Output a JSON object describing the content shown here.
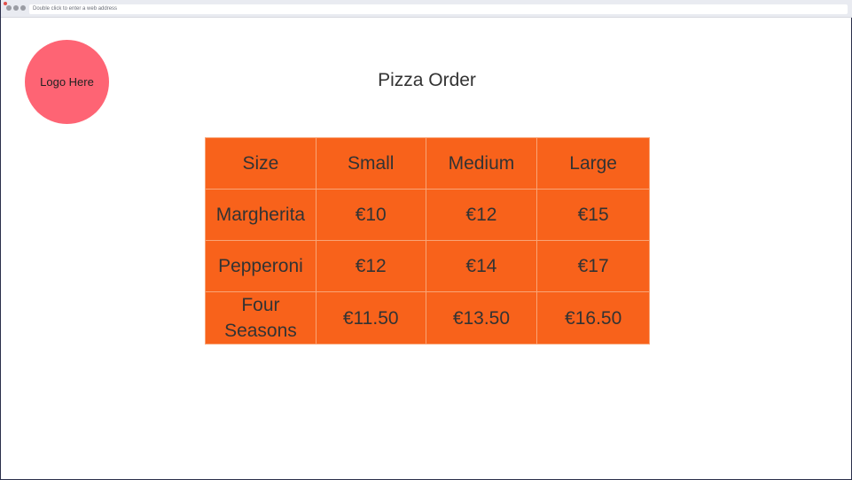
{
  "browser": {
    "address_placeholder": "Double click to enter a web address"
  },
  "logo": {
    "text": "Logo Here",
    "color": "#fe6474"
  },
  "page": {
    "title": "Pizza Order"
  },
  "table": {
    "background_color": "#f8621b",
    "header": [
      "Size",
      "Small",
      "Medium",
      "Large"
    ],
    "rows": [
      [
        "Margherita",
        "€10",
        "€12",
        "€15"
      ],
      [
        "Pepperoni",
        "€12",
        "€14",
        "€17"
      ],
      [
        "Four Seasons",
        "€11.50",
        "€13.50",
        "€16.50"
      ]
    ]
  }
}
